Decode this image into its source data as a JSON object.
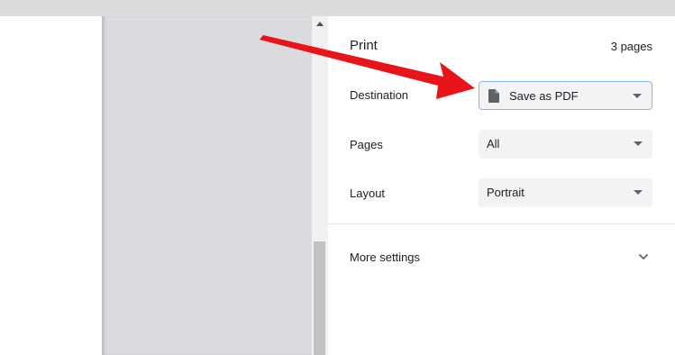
{
  "print": {
    "title": "Print",
    "page_count": "3 pages",
    "destination": {
      "label": "Destination",
      "value": "Save as PDF",
      "icon": "file-icon"
    },
    "pages": {
      "label": "Pages",
      "value": "All"
    },
    "layout": {
      "label": "Layout",
      "value": "Portrait"
    },
    "more_settings": {
      "label": "More settings",
      "icon": "chevron-down-icon"
    }
  },
  "annotation": {
    "color": "#e8141a"
  }
}
